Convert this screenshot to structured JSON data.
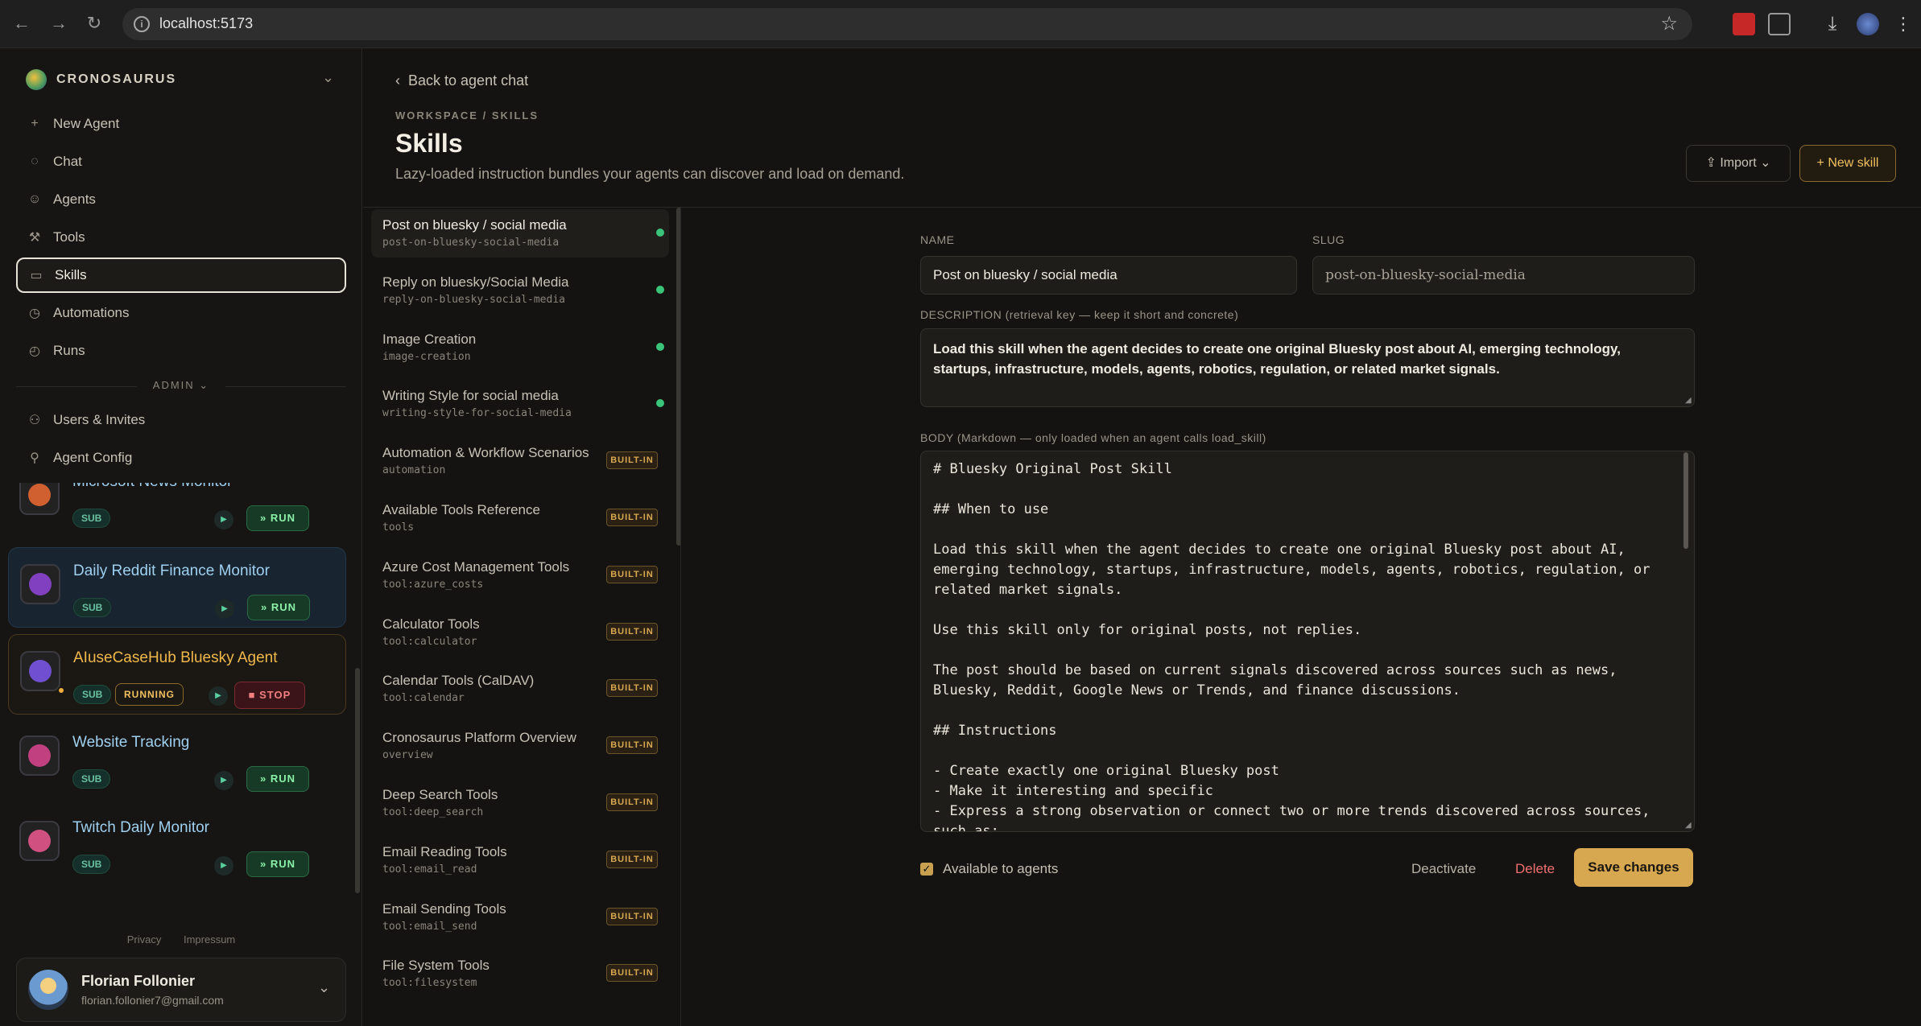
{
  "browser": {
    "url": "localhost:5173"
  },
  "sidebar": {
    "brand": "CRONOSAURUS",
    "nav": [
      {
        "label": "New Agent",
        "icon": "+"
      },
      {
        "label": "Chat",
        "icon": "◌"
      },
      {
        "label": "Agents",
        "icon": "☺"
      },
      {
        "label": "Tools",
        "icon": "⚒"
      },
      {
        "label": "Skills",
        "icon": "▭"
      },
      {
        "label": "Automations",
        "icon": "◷"
      },
      {
        "label": "Runs",
        "icon": "◴"
      }
    ],
    "admin_label": "ADMIN",
    "admin_nav": [
      {
        "label": "Users & Invites",
        "icon": "⚇"
      },
      {
        "label": "Agent Config",
        "icon": "⚲"
      }
    ],
    "agents": [
      {
        "name": "Microsoft News Monitor",
        "tag": "SUB",
        "action": "RUN"
      },
      {
        "name": "Daily Reddit Finance Monitor",
        "tag": "SUB",
        "action": "RUN"
      },
      {
        "name": "AIuseCaseHub Bluesky Agent",
        "tag": "SUB",
        "status": "RUNNING",
        "action": "STOP"
      },
      {
        "name": "Website Tracking",
        "tag": "SUB",
        "action": "RUN"
      },
      {
        "name": "Twitch Daily Monitor",
        "tag": "SUB",
        "action": "RUN"
      }
    ],
    "footer": {
      "privacy": "Privacy",
      "impressum": "Impressum"
    },
    "user": {
      "name": "Florian Follonier",
      "email": "florian.follonier7@gmail.com"
    }
  },
  "main": {
    "back_label": "Back to agent chat",
    "breadcrumb": "WORKSPACE / SKILLS",
    "title": "Skills",
    "subtitle": "Lazy-loaded instruction bundles your agents can discover and load on demand.",
    "import_label": "Import",
    "new_label": "New skill",
    "builtin_label": "BUILT-IN",
    "skills": [
      {
        "name": "Post on bluesky / social media",
        "slug": "post-on-bluesky-social-media",
        "builtin": false
      },
      {
        "name": "Reply on bluesky/Social Media",
        "slug": "reply-on-bluesky-social-media",
        "builtin": false
      },
      {
        "name": "Image Creation",
        "slug": "image-creation",
        "builtin": false
      },
      {
        "name": "Writing Style for social media",
        "slug": "writing-style-for-social-media",
        "builtin": false
      },
      {
        "name": "Automation & Workflow Scenarios",
        "slug": "automation",
        "builtin": true
      },
      {
        "name": "Available Tools Reference",
        "slug": "tools",
        "builtin": true
      },
      {
        "name": "Azure Cost Management Tools",
        "slug": "tool:azure_costs",
        "builtin": true
      },
      {
        "name": "Calculator Tools",
        "slug": "tool:calculator",
        "builtin": true
      },
      {
        "name": "Calendar Tools (CalDAV)",
        "slug": "tool:calendar",
        "builtin": true
      },
      {
        "name": "Cronosaurus Platform Overview",
        "slug": "overview",
        "builtin": true
      },
      {
        "name": "Deep Search Tools",
        "slug": "tool:deep_search",
        "builtin": true
      },
      {
        "name": "Email Reading Tools",
        "slug": "tool:email_read",
        "builtin": true
      },
      {
        "name": "Email Sending Tools",
        "slug": "tool:email_send",
        "builtin": true
      },
      {
        "name": "File System Tools",
        "slug": "tool:filesystem",
        "builtin": true
      }
    ],
    "form": {
      "name_label": "NAME",
      "name_value": "Post on bluesky / social media",
      "slug_label": "SLUG",
      "slug_value": "post-on-bluesky-social-media",
      "desc_label": "DESCRIPTION (retrieval key — keep it short and concrete)",
      "desc_value": "Load this skill when the agent decides to create one original Bluesky post about AI, emerging technology, startups, infrastructure, models, agents, robotics, regulation, or related market signals.",
      "body_label": "BODY (Markdown — only loaded when an agent calls load_skill)",
      "body_value": "# Bluesky Original Post Skill\n\n## When to use\n\nLoad this skill when the agent decides to create one original Bluesky post about AI, emerging technology, startups, infrastructure, models, agents, robotics, regulation, or related market signals.\n\nUse this skill only for original posts, not replies.\n\nThe post should be based on current signals discovered across sources such as news, Bluesky, Reddit, Google News or Trends, and finance discussions.\n\n## Instructions\n\n- Create exactly one original Bluesky post\n- Make it interesting and specific\n- Express a strong observation or connect two or more trends discovered across sources, such as:",
      "available_label": "Available to agents",
      "deactivate_label": "Deactivate",
      "delete_label": "Delete",
      "save_label": "Save changes"
    }
  }
}
